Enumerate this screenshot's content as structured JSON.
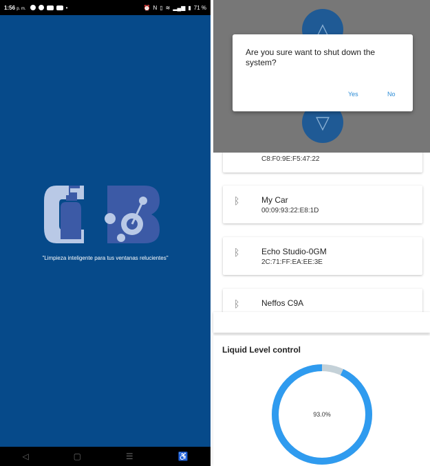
{
  "status_bar": {
    "time": "1:56",
    "ampm": "p. m.",
    "battery": "71 %"
  },
  "splash": {
    "logo_text": "CB",
    "tagline": "\"Limpieza inteligente para tus ventanas relucientes\""
  },
  "dialog": {
    "message": "Are you sure want to shut down the system?",
    "yes_label": "Yes",
    "no_label": "No"
  },
  "devices": [
    {
      "name": "",
      "mac": "C8:F0:9E:F5:47:22"
    },
    {
      "name": "My Car",
      "mac": "00:09:93:22:E8:1D"
    },
    {
      "name": "Echo Studio-0GM",
      "mac": "2C:71:FF:EA:EE:3E"
    },
    {
      "name": "Neffos C9A",
      "mac": ""
    }
  ],
  "liquid": {
    "title": "Liquid Level control",
    "percent_label": "93.0%",
    "level": 0.93,
    "fill_color": "#2f9bef",
    "track_color": "#c4d1d8"
  },
  "colors": {
    "splash_bg": "#064a8a",
    "accent": "#2a8bd6"
  }
}
